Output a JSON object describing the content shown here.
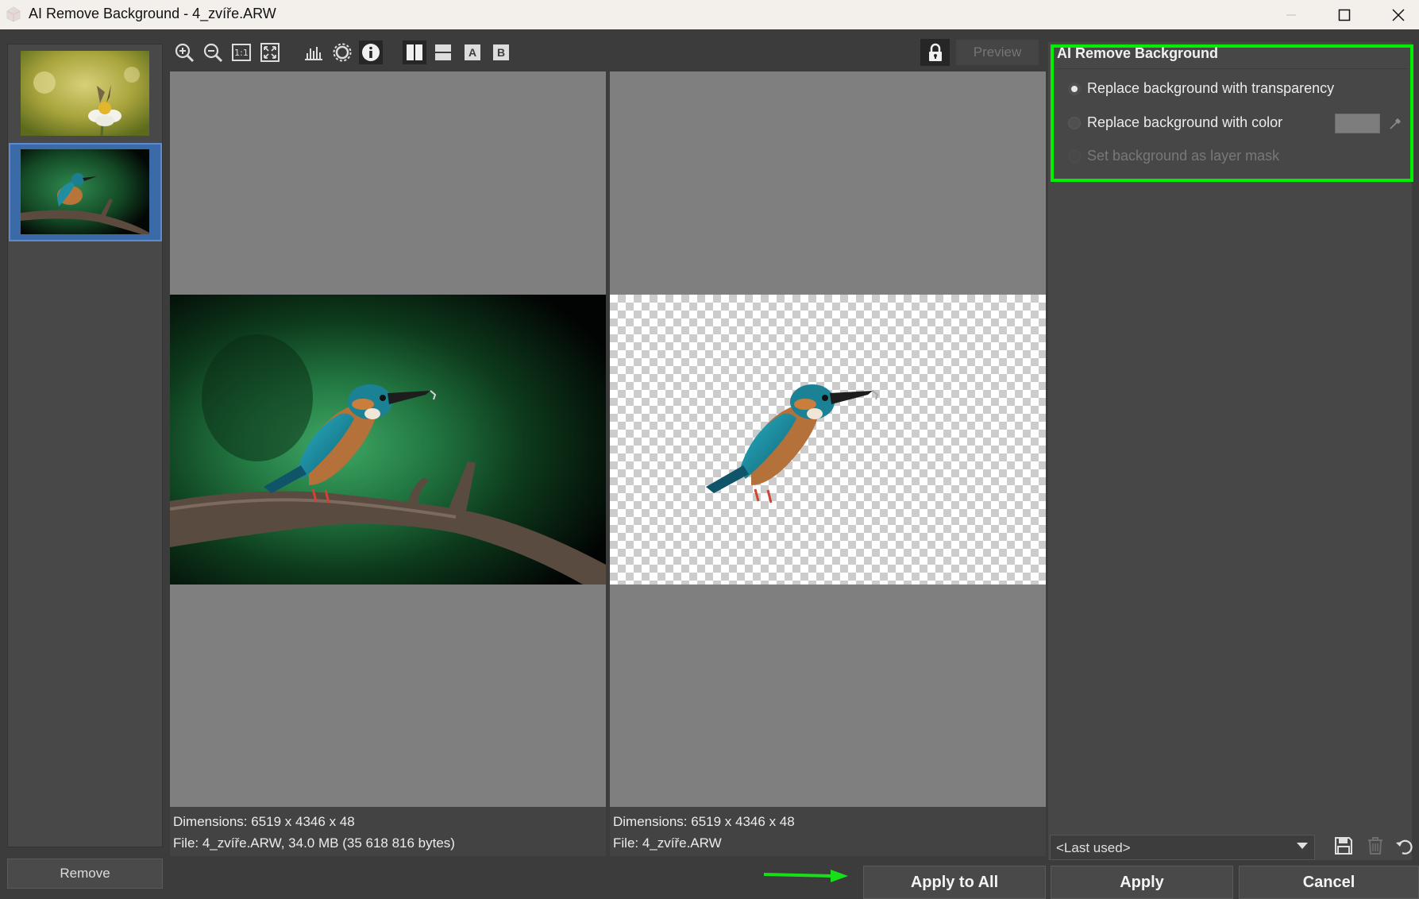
{
  "window": {
    "title": "AI Remove Background - 4_zvíře.ARW",
    "controls": [
      "minimize",
      "maximize",
      "close"
    ]
  },
  "toolbar": {
    "icons": [
      "zoom-in-icon",
      "zoom-out-icon",
      "actual-size-icon",
      "fit-to-window-icon",
      "histogram-icon",
      "exposure-icon",
      "info-icon",
      "split-vertical-icon",
      "split-horizontal-icon",
      "view-a-icon",
      "view-b-icon"
    ],
    "actual_size_label": "1:1",
    "view_a_label": "A",
    "view_b_label": "B",
    "preview_label": "Preview"
  },
  "thumbnails": {
    "items": [
      {
        "name": "butterfly-on-daisy",
        "selected": false
      },
      {
        "name": "kingfisher-on-branch",
        "selected": true
      }
    ],
    "remove_label": "Remove"
  },
  "left_pane": {
    "dimensions": "Dimensions: 6519 x 4346 x 48",
    "file": "File: 4_zvíře.ARW, 34.0 MB (35 618 816 bytes)"
  },
  "right_pane": {
    "dimensions": "Dimensions: 6519 x 4346 x 48",
    "file": "File: 4_zvíře.ARW"
  },
  "options": {
    "title": "AI Remove Background",
    "radio_transparency": "Replace background with transparency",
    "radio_color": "Replace background with color",
    "radio_layer_mask": "Set background as layer mask",
    "selected": "transparency",
    "swatch_color": "#7d7d7d"
  },
  "preset": {
    "value": "<Last used>"
  },
  "buttons": {
    "apply_all": "Apply to All",
    "apply": "Apply",
    "cancel": "Cancel"
  },
  "colors": {
    "highlight": "#00f000",
    "selection": "#3a6ba8"
  }
}
